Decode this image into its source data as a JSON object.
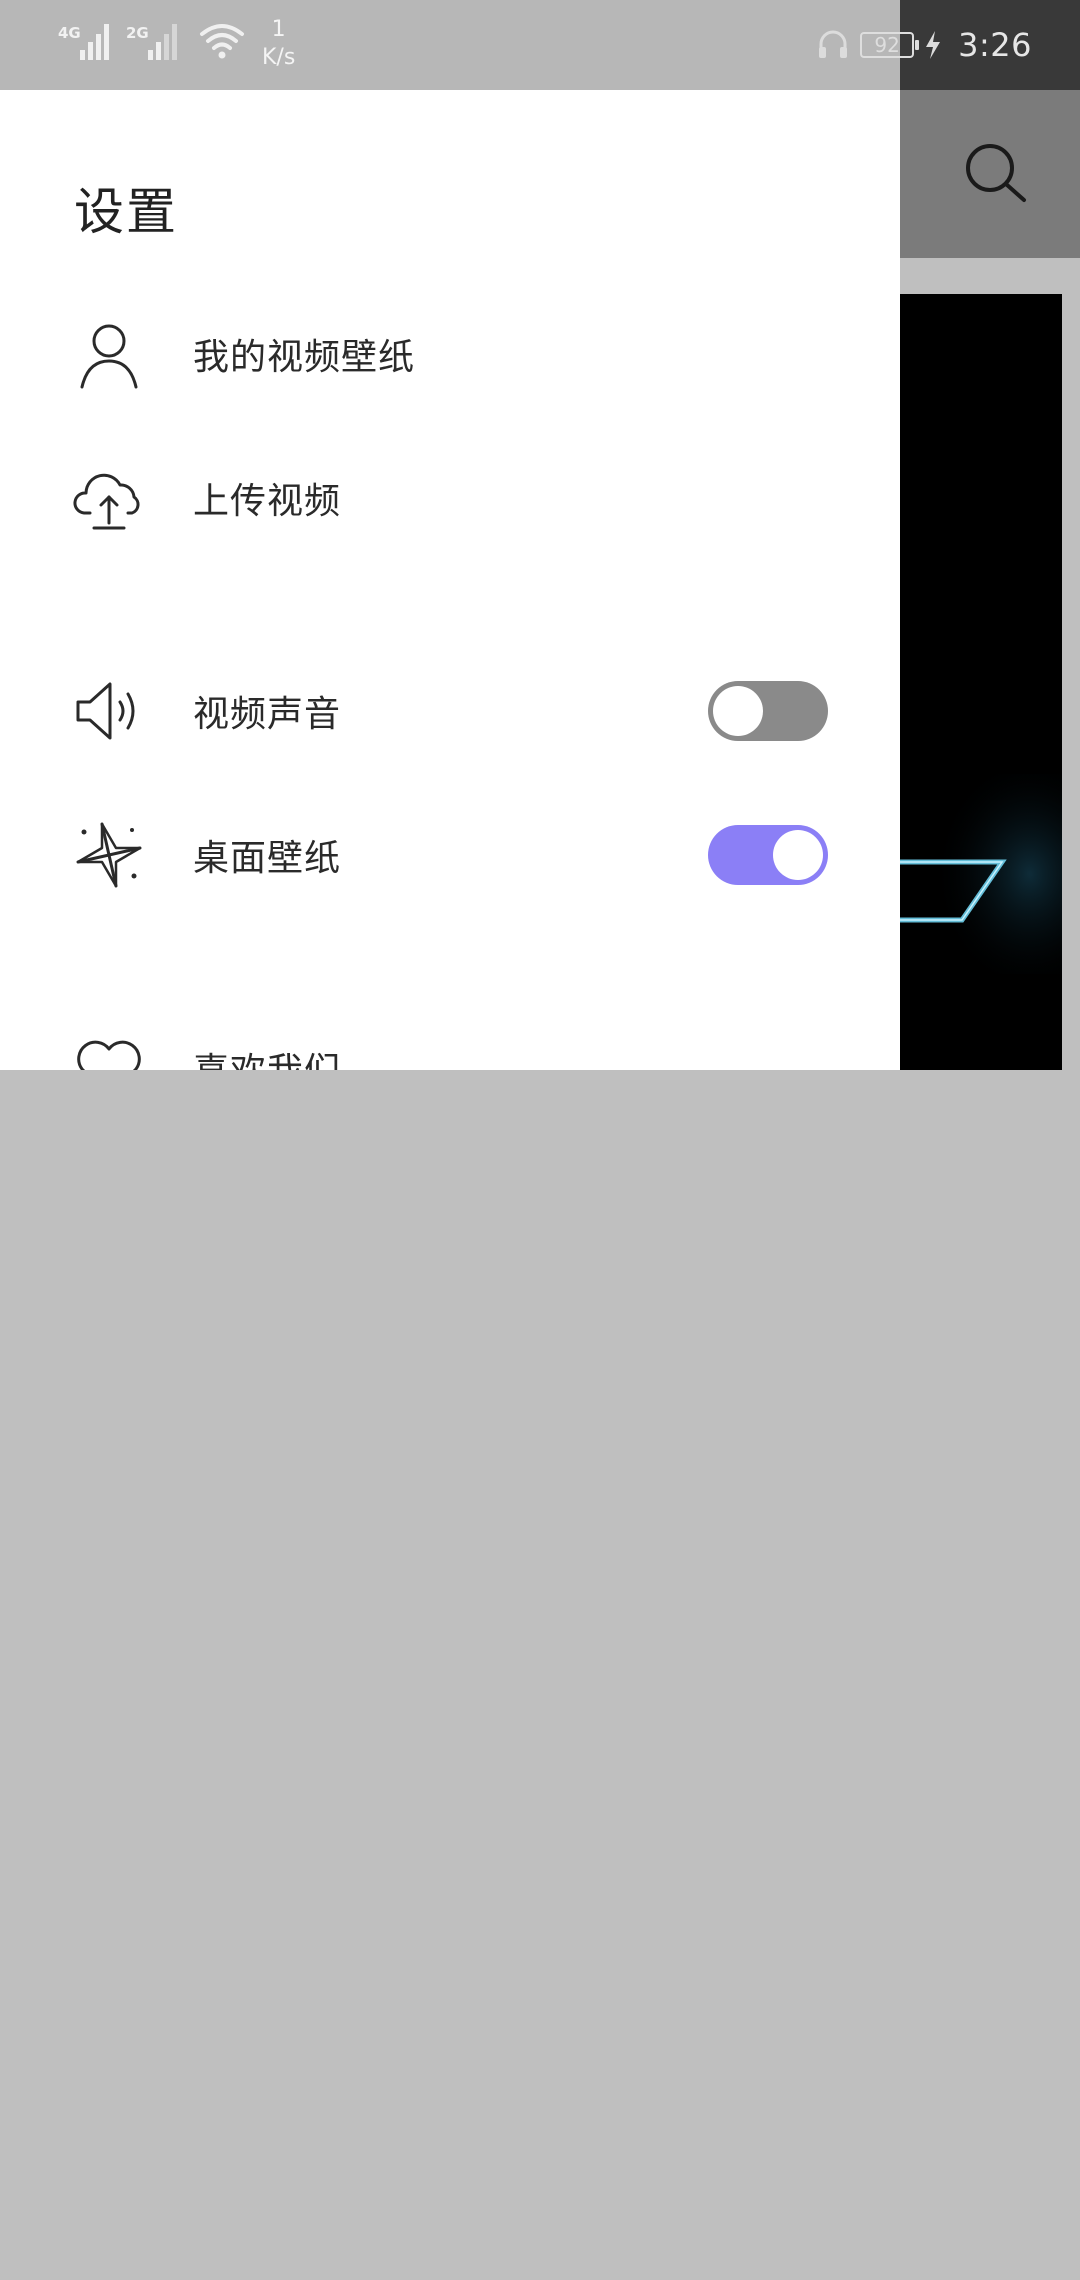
{
  "status_bar": {
    "network_1": "4G",
    "network_2": "2G",
    "speed_value": "1",
    "speed_unit": "K/s",
    "battery": "92",
    "time": "3:26"
  },
  "drawer": {
    "title": "设置",
    "items": [
      {
        "label": "我的视频壁纸",
        "icon": "user-icon"
      },
      {
        "label": "上传视频",
        "icon": "cloud-upload-icon"
      },
      {
        "label": "视频声音",
        "icon": "speaker-icon",
        "toggle": false
      },
      {
        "label": "桌面壁纸",
        "icon": "sparkle-star-icon",
        "toggle": true
      },
      {
        "label": "喜欢我们",
        "icon": "heart-icon"
      }
    ]
  },
  "colors": {
    "toggle_on": "#8b7ff6",
    "toggle_off": "#8a8a8a",
    "scrim": "#bfbfbf"
  }
}
